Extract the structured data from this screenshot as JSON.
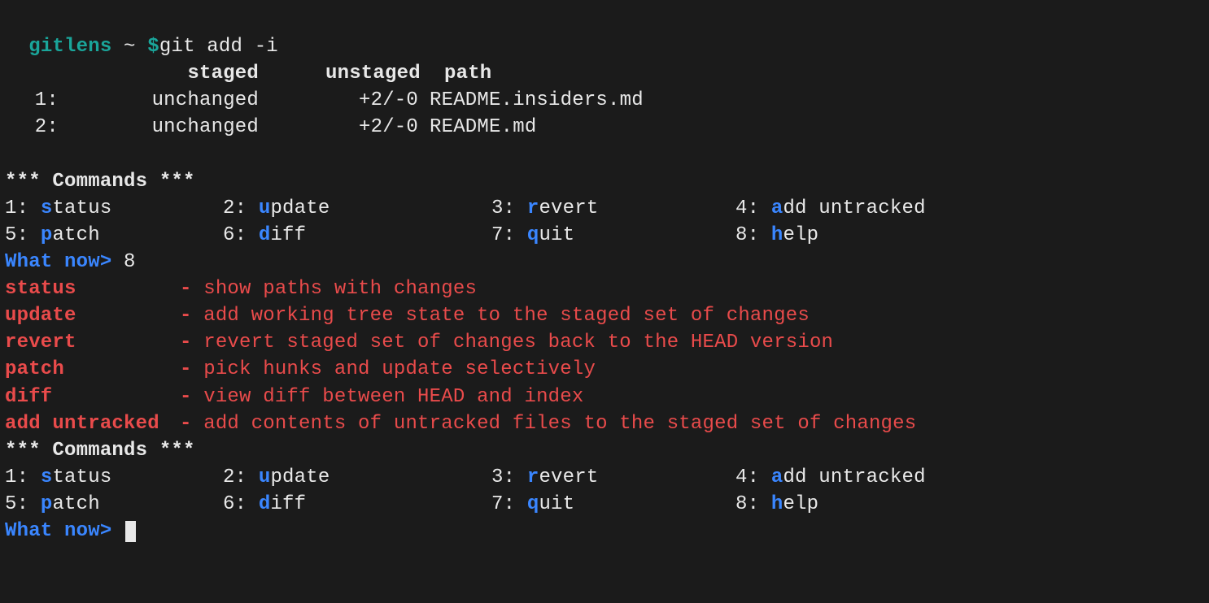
{
  "prompt": {
    "dir": "gitlens",
    "sep": "~",
    "sigil": "$",
    "command": "git add -i"
  },
  "status_header": {
    "staged": "staged",
    "unstaged": "unstaged",
    "path": "path"
  },
  "files": [
    {
      "num": "1:",
      "staged": "unchanged",
      "unstaged": "+2/-0",
      "path": "README.insiders.md"
    },
    {
      "num": "2:",
      "staged": "unchanged",
      "unstaged": "+2/-0",
      "path": "README.md"
    }
  ],
  "commands_title": "*** Commands ***",
  "commands": [
    {
      "num": "1:",
      "hi": "s",
      "rest": "tatus"
    },
    {
      "num": "2:",
      "hi": "u",
      "rest": "pdate"
    },
    {
      "num": "3:",
      "hi": "r",
      "rest": "evert"
    },
    {
      "num": "4:",
      "hi": "a",
      "rest": "dd untracked"
    },
    {
      "num": "5:",
      "hi": "p",
      "rest": "atch"
    },
    {
      "num": "6:",
      "hi": "d",
      "rest": "iff"
    },
    {
      "num": "7:",
      "hi": "q",
      "rest": "uit"
    },
    {
      "num": "8:",
      "hi": "h",
      "rest": "elp"
    }
  ],
  "what_now_prompt": "What now>",
  "user_input_1": "8",
  "help": [
    {
      "name": "status",
      "desc": "show paths with changes"
    },
    {
      "name": "update",
      "desc": "add working tree state to the staged set of changes"
    },
    {
      "name": "revert",
      "desc": "revert staged set of changes back to the HEAD version"
    },
    {
      "name": "patch",
      "desc": "pick hunks and update selectively"
    },
    {
      "name": "diff",
      "desc": "view diff between HEAD and index"
    },
    {
      "name": "add untracked",
      "desc": "add contents of untracked files to the staged set of changes"
    }
  ],
  "dash": "-"
}
